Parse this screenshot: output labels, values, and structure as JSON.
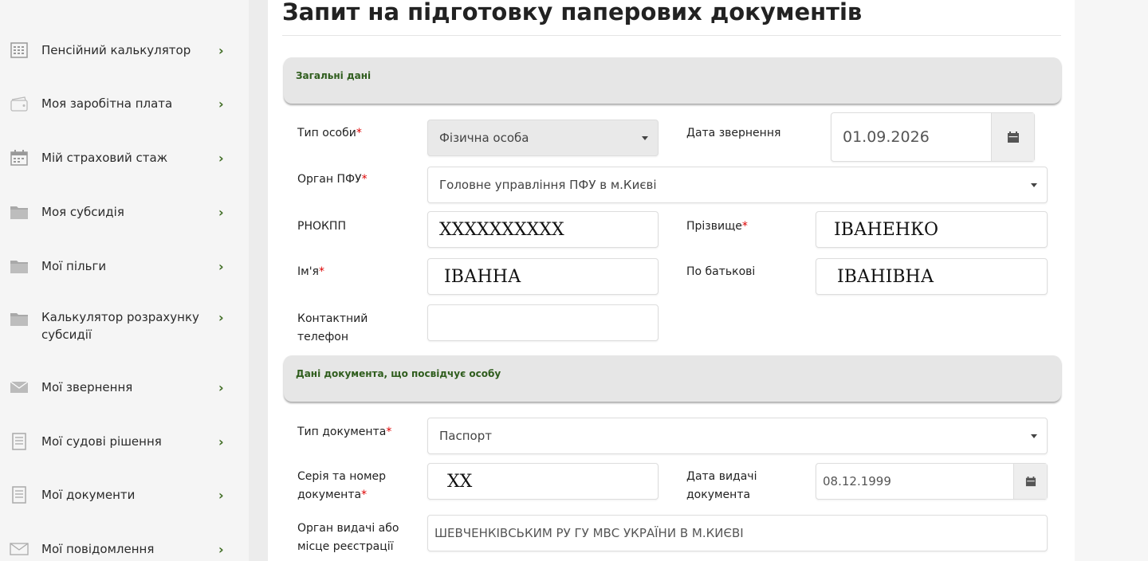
{
  "sidebar": {
    "items": [
      {
        "label": "Пенсійний калькулятор",
        "icon": "calculator-icon"
      },
      {
        "label": "Моя заробітна плата",
        "icon": "wallet-icon"
      },
      {
        "label": "Мій страховий стаж",
        "icon": "calendar-icon"
      },
      {
        "label": "Моя субсидія",
        "icon": "folder-icon"
      },
      {
        "label": "Мої пільги",
        "icon": "folder-icon"
      },
      {
        "label": "Калькулятор розрахунку субсидії",
        "icon": "folder-icon"
      },
      {
        "label": "Мої звернення",
        "icon": "envelope-icon"
      },
      {
        "label": "Мої судові рішення",
        "icon": "document-icon"
      },
      {
        "label": "Мої документи",
        "icon": "document-icon"
      },
      {
        "label": "Мої повідомлення",
        "icon": "envelope-outline-icon"
      }
    ],
    "chevron": "›"
  },
  "page": {
    "title": "Запит на підготовку паперових документів"
  },
  "sections": {
    "general": "Загальні дані",
    "identity_doc": "Дані документа, що посвідчує особу"
  },
  "form": {
    "person_type": {
      "label": "Тип особи",
      "required": "*",
      "value": "Фізична особа"
    },
    "request_date": {
      "label": "Дата звернення",
      "value": "01.09.2026"
    },
    "pfu_body": {
      "label": "Орган ПФУ",
      "required": "*",
      "value": "Головне управління ПФУ в м.Києві"
    },
    "rnokpp": {
      "label": "РНОКПП",
      "value": "XXXXXXXXXX"
    },
    "surname": {
      "label": "Прізвище",
      "required": "*",
      "value": "ІВАНЕНКО"
    },
    "name": {
      "label": "Ім'я",
      "required": "*",
      "value": "ІВАННА"
    },
    "patronymic": {
      "label": "По батькові",
      "value": "ІВАНІВНА"
    },
    "phone": {
      "label": "Контактний телефон",
      "value": ""
    },
    "doc_type": {
      "label": "Тип документа",
      "required": "*",
      "value": "Паспорт"
    },
    "doc_number": {
      "label": "Серія та номер документа",
      "required": "*",
      "value": "XX"
    },
    "issue_date": {
      "label": "Дата видачі документа",
      "value": "08.12.1999"
    },
    "issuer": {
      "label": "Орган видачі або місце реєстрації",
      "value": "ШЕВЧЕНКІВСЬКИМ РУ ГУ МВС УКРАЇНИ В М.КИЄВІ"
    }
  },
  "colors": {
    "accent": "#3d6b21",
    "section_bg": "#e6e6e6",
    "required": "#dd0000"
  }
}
